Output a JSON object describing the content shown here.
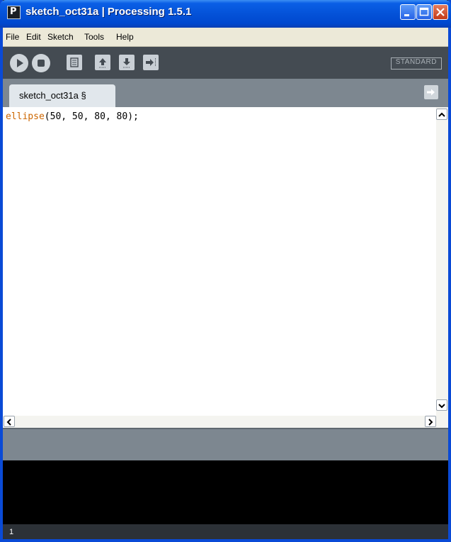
{
  "window": {
    "title": "sketch_oct31a  |  Processing 1.5.1",
    "app_icon_letter": "P"
  },
  "menu": [
    "File",
    "Edit",
    "Sketch",
    "Tools",
    "Help"
  ],
  "toolbar": {
    "mode_label": "STANDARD",
    "buttons": [
      "run-icon",
      "stop-icon",
      "new-icon",
      "open-icon",
      "save-icon",
      "export-icon"
    ]
  },
  "tabs": [
    {
      "label": "sketch_oct31a §"
    }
  ],
  "editor": {
    "keyword": "ellipse",
    "rest": "(50, 50, 80, 80);"
  },
  "status": {
    "message": "",
    "line_number": "1"
  },
  "colors": {
    "keyword": "#cc6600",
    "toolbar": "#444b52",
    "tabbar": "#7d8790",
    "console": "#000000"
  }
}
